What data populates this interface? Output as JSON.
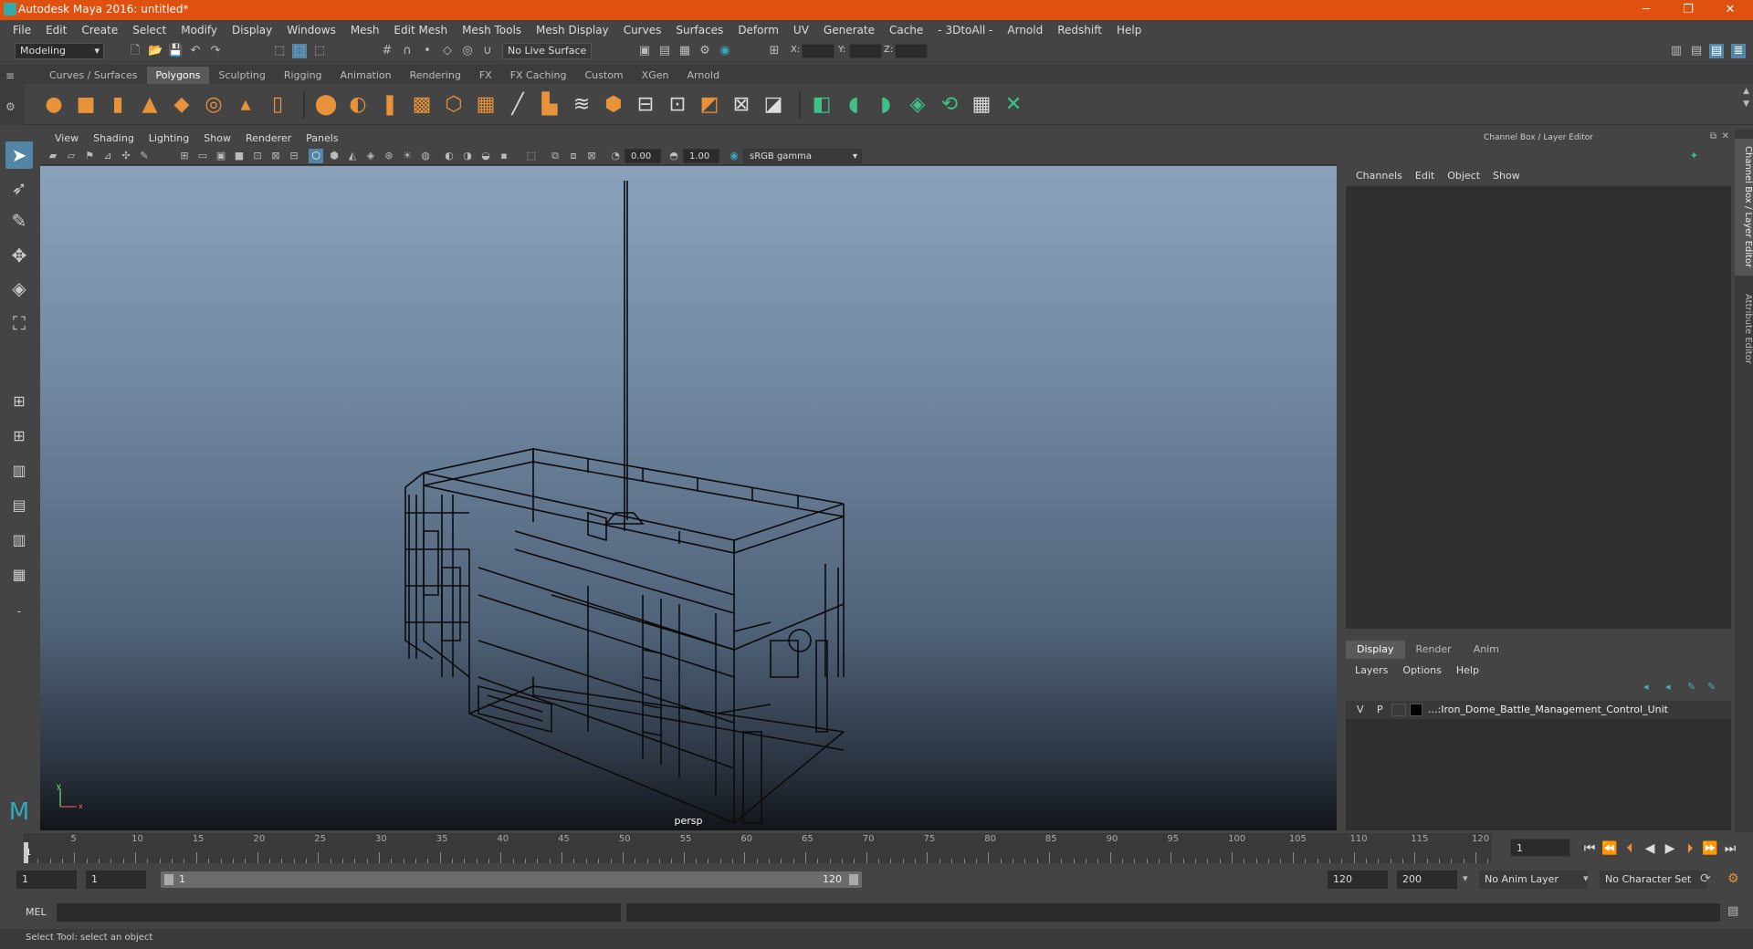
{
  "window": {
    "title": "Autodesk Maya 2016: untitled*"
  },
  "menubar": [
    "File",
    "Edit",
    "Create",
    "Select",
    "Modify",
    "Display",
    "Windows",
    "Mesh",
    "Edit Mesh",
    "Mesh Tools",
    "Mesh Display",
    "Curves",
    "Surfaces",
    "Deform",
    "UV",
    "Generate",
    "Cache",
    "- 3DtoAll -",
    "Arnold",
    "Redshift",
    "Help"
  ],
  "statusline": {
    "mode": "Modeling",
    "live_surface": "No Live Surface",
    "x_label": "X:",
    "y_label": "Y:",
    "z_label": "Z:"
  },
  "shelf_tabs": [
    "Curves / Surfaces",
    "Polygons",
    "Sculpting",
    "Rigging",
    "Animation",
    "Rendering",
    "FX",
    "FX Caching",
    "Custom",
    "XGen",
    "Arnold"
  ],
  "active_shelf": "Polygons",
  "viewport": {
    "menu": [
      "View",
      "Shading",
      "Lighting",
      "Show",
      "Renderer",
      "Panels"
    ],
    "exposure": "0.00",
    "gamma": "1.00",
    "color_space": "sRGB gamma",
    "camera_label": "persp",
    "axis_x": "x",
    "axis_y": "y"
  },
  "right_panel": {
    "title": "Channel Box / Layer Editor",
    "menu": [
      "Channels",
      "Edit",
      "Object",
      "Show"
    ],
    "tabs": [
      "Display",
      "Render",
      "Anim"
    ],
    "active_tab": "Display",
    "layer_menu": [
      "Layers",
      "Options",
      "Help"
    ],
    "layer": {
      "v": "V",
      "p": "P",
      "name": "...:Iron_Dome_Battle_Management_Control_Unit"
    },
    "side_tabs": [
      "Channel Box / Layer Editor",
      "Attribute Editor"
    ]
  },
  "timeline": {
    "start_label": "1",
    "ticks": [
      5,
      10,
      15,
      20,
      25,
      30,
      35,
      40,
      45,
      50,
      55,
      60,
      65,
      70,
      75,
      80,
      85,
      90,
      95,
      100,
      105,
      110,
      115,
      120
    ],
    "current_frame": "1"
  },
  "range": {
    "start": "1",
    "playback_start": "1",
    "bar_start": "1",
    "bar_end": "120",
    "playback_end": "120",
    "end": "200",
    "anim_layer": "No Anim Layer",
    "character_set": "No Character Set"
  },
  "command": {
    "label": "MEL"
  },
  "status": {
    "help": "Select Tool: select an object"
  },
  "colors": {
    "title_bar": "#e0500f",
    "active_tool": "#5285a6",
    "accent_green": "#3ec28a",
    "shelf_orange": "#e8933a"
  }
}
